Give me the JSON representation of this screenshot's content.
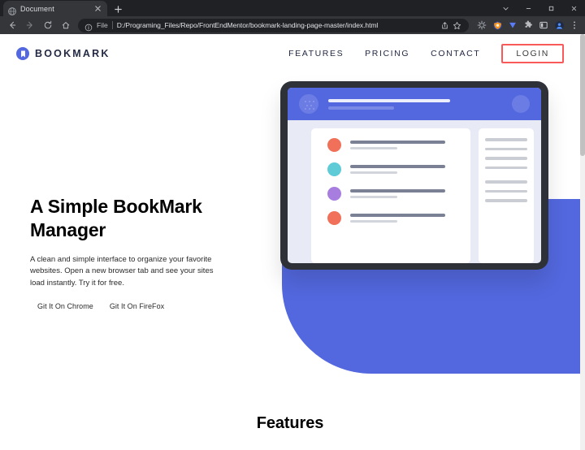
{
  "browser": {
    "tab": {
      "title": "Document",
      "favicon": "globe-icon",
      "close": "close-icon"
    },
    "new_tab_label": "+",
    "window_controls": {
      "minimize_group": "chevron-down-icon",
      "minimize": "minimize-icon",
      "maximize": "maximize-icon",
      "close": "close-icon"
    },
    "nav": {
      "back": "back-arrow-icon",
      "forward": "forward-arrow-icon",
      "reload": "reload-icon",
      "home": "home-icon"
    },
    "omnibox": {
      "info_icon": "info-circle-icon",
      "scheme_label": "File",
      "url": "D:/Programing_Files/Repo/FrontEndMentor/bookmark-landing-page-master/index.html",
      "share_icon": "share-icon",
      "bookmark_icon": "star-icon"
    },
    "extensions": [
      {
        "name": "extension-gear-icon",
        "color": "#9aa0a6"
      },
      {
        "name": "extension-shield-icon",
        "color": "#f6921e"
      },
      {
        "name": "extension-v-icon",
        "color": "#5b7cfa"
      },
      {
        "name": "extensions-puzzle-icon",
        "color": "#b9bbbe"
      },
      {
        "name": "side-panel-icon",
        "color": "#c7c9cd"
      },
      {
        "name": "profile-avatar-icon",
        "color": "#2a66d9"
      },
      {
        "name": "browser-menu-icon",
        "color": "#c7c9cd"
      }
    ]
  },
  "page": {
    "header": {
      "logo_text": "BOOKMARK",
      "logo_mark": "bookmark-icon",
      "nav_links": [
        {
          "label": "FEATURES"
        },
        {
          "label": "PRICING"
        },
        {
          "label": "CONTACT"
        }
      ],
      "login_label": "LOGIN",
      "login_border_color": "#fa5959"
    },
    "hero": {
      "title": "A Simple BookMark Manager",
      "description": "A clean and simple interface to organize your favorite websites. Open a new browser tab and see your sites load instantly. Try it for free.",
      "buttons": [
        {
          "label": "Git It On Chrome"
        },
        {
          "label": "Git It On FireFox"
        }
      ],
      "illustration": {
        "name": "tablet-bookmark-mockup",
        "accent_color": "#5368df",
        "list_dot_colors": [
          "#f0705a",
          "#5ecbd6",
          "#a77ee0",
          "#f0705a"
        ],
        "right_card_line_count": 7
      }
    },
    "features": {
      "title": "Features"
    }
  }
}
